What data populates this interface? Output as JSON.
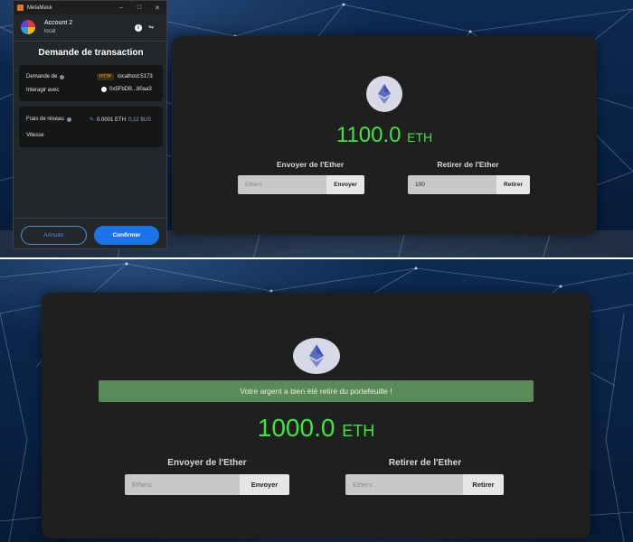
{
  "metamask": {
    "window_title": "MetaMask",
    "account_name": "Account 2",
    "network": "local",
    "heading": "Demande de transaction",
    "request_from_label": "Demande de",
    "request_badge": "HTTP",
    "request_origin": "localhost:5173",
    "interact_label": "Interagir avec",
    "interact_address": "0x5FbDB...80aa3",
    "fee_label": "Frais de réseau",
    "fee_eth": "0.0001 ETH",
    "fee_usd": "0,12 $US",
    "speed_label": "Vitesse",
    "cancel_label": "Annuler",
    "confirm_label": "Confirmer",
    "icons": [
      "fox-icon",
      "avatar",
      "info-icon",
      "settings-icon",
      "question-icon",
      "warning-icon",
      "address-icon",
      "pencil-icon"
    ]
  },
  "dapp_top": {
    "balance": "1100.0",
    "unit": "ETH",
    "send_title": "Envoyer de l'Ether",
    "send_placeholder": "Ethers",
    "send_button": "Envoyer",
    "withdraw_title": "Retirer de l'Ether",
    "withdraw_value": "100",
    "withdraw_button": "Retirer"
  },
  "dapp_bottom": {
    "success_message": "Votre argent a bien été retiré du portefeuille !",
    "balance": "1000.0",
    "unit": "ETH",
    "send_title": "Envoyer de l'Ether",
    "send_placeholder": "Ethers",
    "send_button": "Envoyer",
    "withdraw_title": "Retirer de l'Ether",
    "withdraw_placeholder": "Ethers",
    "withdraw_button": "Retirer"
  },
  "colors": {
    "balance_green": "#3ee53e",
    "success_bg": "#5a8a58",
    "card_bg": "#1f1f1f",
    "metamask_blue": "#1a73e8"
  }
}
